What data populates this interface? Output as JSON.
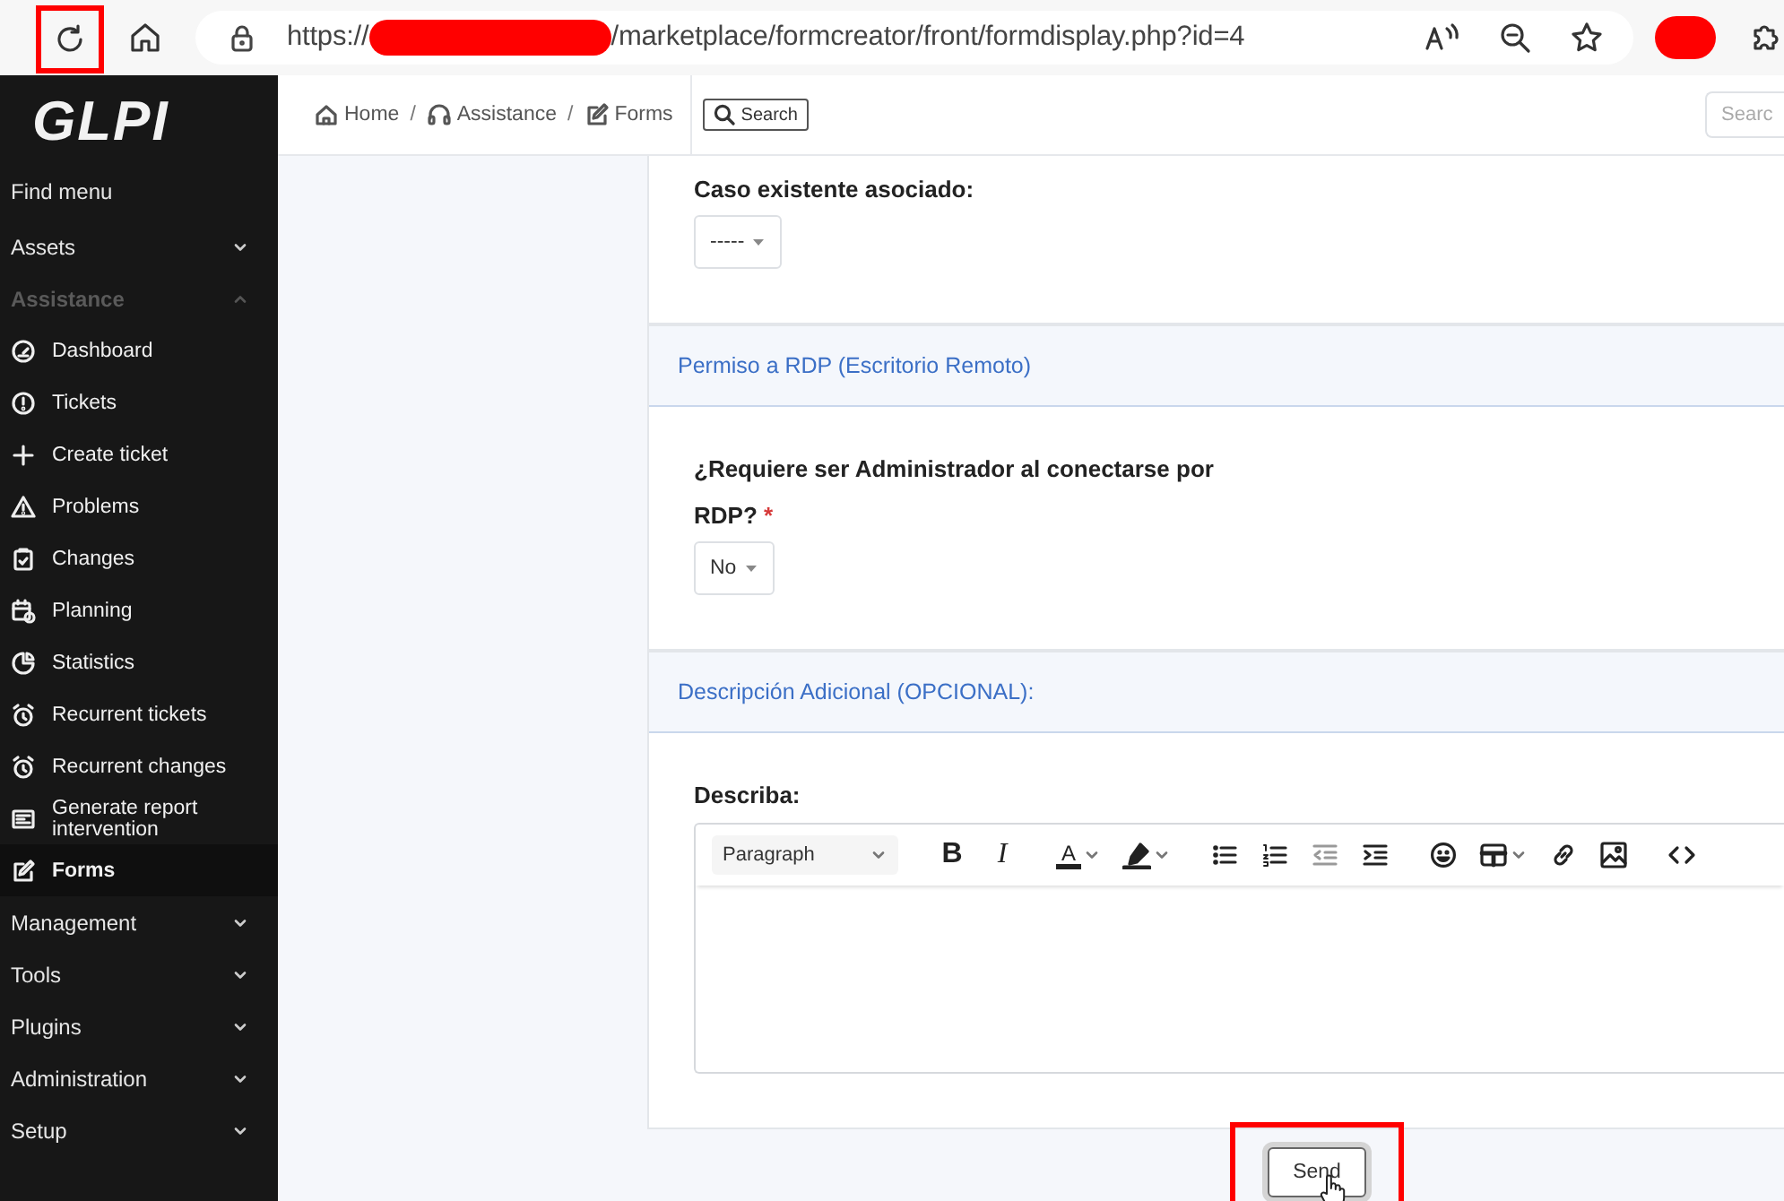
{
  "browser": {
    "reload": {
      "annotated": true
    },
    "url": {
      "scheme": "https://",
      "redacted": true,
      "path": "/marketplace/formcreator/front/formdisplay.php?id=4"
    },
    "profile": {
      "redacted": true
    }
  },
  "sidebar": {
    "logo": "GLPI",
    "items": [
      {
        "label": "Find menu",
        "kind": "link"
      },
      {
        "label": "Assets",
        "kind": "section",
        "expanded": false
      },
      {
        "label": "Assistance",
        "kind": "section",
        "expanded": true,
        "children": [
          {
            "label": "Dashboard",
            "selected": false
          },
          {
            "label": "Tickets",
            "selected": false
          },
          {
            "label": "Create ticket",
            "selected": false
          },
          {
            "label": "Problems",
            "selected": false
          },
          {
            "label": "Changes",
            "selected": false
          },
          {
            "label": "Planning",
            "selected": false
          },
          {
            "label": "Statistics",
            "selected": false
          },
          {
            "label": "Recurrent tickets",
            "selected": false
          },
          {
            "label": "Recurrent changes",
            "selected": false
          },
          {
            "label": "Generate report intervention",
            "selected": false
          },
          {
            "label": "Forms",
            "selected": true
          }
        ]
      },
      {
        "label": "Management",
        "kind": "section",
        "expanded": false
      },
      {
        "label": "Tools",
        "kind": "section",
        "expanded": false
      },
      {
        "label": "Plugins",
        "kind": "section",
        "expanded": false
      },
      {
        "label": "Administration",
        "kind": "section",
        "expanded": false
      },
      {
        "label": "Setup",
        "kind": "section",
        "expanded": false
      }
    ]
  },
  "header": {
    "breadcrumbs": [
      "Home",
      "Assistance",
      "Forms"
    ],
    "separator": "/",
    "search_button": "Search",
    "search_field": {
      "placeholder": "Searc"
    }
  },
  "form": {
    "sections": [
      {
        "kind": "questions",
        "questions": [
          {
            "kind": "select",
            "label": "Caso existente asociado:",
            "value": "-----"
          }
        ]
      },
      {
        "kind": "header",
        "title": "Permiso a RDP (Escritorio Remoto)"
      },
      {
        "kind": "questions",
        "questions": [
          {
            "kind": "select",
            "label": "¿Requiere ser Administrador al conectarse por RDP?",
            "required_mark": "*",
            "value": "No"
          }
        ]
      },
      {
        "kind": "header",
        "title": "Descripción Adicional (OPCIONAL):"
      },
      {
        "kind": "questions",
        "questions": [
          {
            "kind": "editor",
            "label": "Describa:",
            "toolbar": [
              [
                {
                  "kind": "select",
                  "label": "Paragraph"
                }
              ],
              [
                {
                  "kind": "text",
                  "label": "B"
                },
                {
                  "kind": "text",
                  "label": "I"
                }
              ],
              [
                {
                  "kind": "color",
                  "label": "A",
                  "caret": true
                },
                {
                  "kind": "icon",
                  "caret": true
                }
              ],
              [
                {
                  "kind": "icon"
                },
                {
                  "kind": "icon"
                },
                {
                  "kind": "icon",
                  "disabled": true
                },
                {
                  "kind": "icon"
                }
              ],
              [
                {
                  "kind": "icon"
                },
                {
                  "kind": "icon",
                  "caret": true
                },
                {
                  "kind": "icon"
                },
                {
                  "kind": "icon"
                }
              ],
              [
                {
                  "kind": "icon"
                }
              ]
            ]
          }
        ]
      }
    ],
    "submit": {
      "label": "Send",
      "annotated": true
    }
  }
}
